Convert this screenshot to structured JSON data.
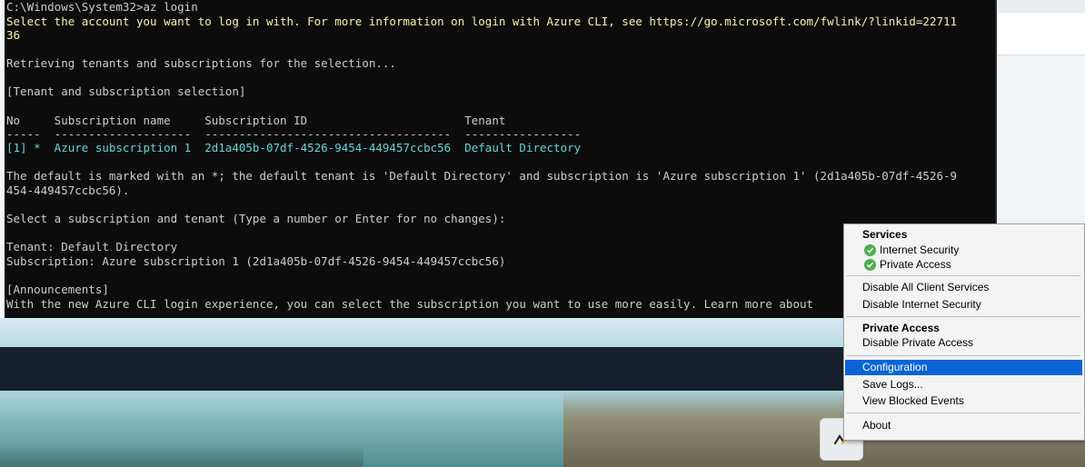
{
  "terminal": {
    "lines": [
      {
        "text": "C:\\Windows\\System32>az login",
        "color": "default"
      },
      {
        "text": "Select the account you want to log in with. For more information on login with Azure CLI, see https://go.microsoft.com/fwlink/?linkid=22711",
        "color": "yellow"
      },
      {
        "text": "36",
        "color": "yellow"
      },
      {
        "text": "",
        "color": "default"
      },
      {
        "text": "Retrieving tenants and subscriptions for the selection...",
        "color": "default"
      },
      {
        "text": "",
        "color": "default"
      },
      {
        "text": "[Tenant and subscription selection]",
        "color": "default"
      },
      {
        "text": "",
        "color": "default"
      },
      {
        "text": "No     Subscription name     Subscription ID                       Tenant",
        "color": "default"
      },
      {
        "text": "-----  --------------------  ------------------------------------  -----------------",
        "color": "default"
      },
      {
        "text": "[1] *  Azure subscription 1  2d1a405b-07df-4526-9454-449457ccbc56  Default Directory",
        "color": "cyan"
      },
      {
        "text": "",
        "color": "default"
      },
      {
        "text": "The default is marked with an *; the default tenant is 'Default Directory' and subscription is 'Azure subscription 1' (2d1a405b-07df-4526-9",
        "color": "default"
      },
      {
        "text": "454-449457ccbc56).",
        "color": "default"
      },
      {
        "text": "",
        "color": "default"
      },
      {
        "text": "Select a subscription and tenant (Type a number or Enter for no changes):",
        "color": "default"
      },
      {
        "text": "",
        "color": "default"
      },
      {
        "text": "Tenant: Default Directory",
        "color": "default"
      },
      {
        "text": "Subscription: Azure subscription 1 (2d1a405b-07df-4526-9454-449457ccbc56)",
        "color": "default"
      },
      {
        "text": "",
        "color": "default"
      },
      {
        "text": "[Announcements]",
        "color": "default"
      },
      {
        "text": "With the new Azure CLI login experience, you can select the subscription you want to use more easily. Learn more about",
        "color": "default"
      }
    ]
  },
  "context_menu": {
    "services_header": "Services",
    "internet_security": "Internet Security",
    "private_access_status": "Private Access",
    "disable_all_client_services": "Disable All Client Services",
    "disable_internet_security": "Disable Internet Security",
    "private_access_header": "Private Access",
    "disable_private_access": "Disable Private Access",
    "configuration": "Configuration",
    "save_logs": "Save Logs...",
    "view_blocked_events": "View Blocked Events",
    "about": "About",
    "status_icon": "check-circle-icon",
    "accent_color": "#0a64d6",
    "status_color": "#4caf50"
  },
  "tray": {
    "icon": "zscaler-tray-icon"
  }
}
